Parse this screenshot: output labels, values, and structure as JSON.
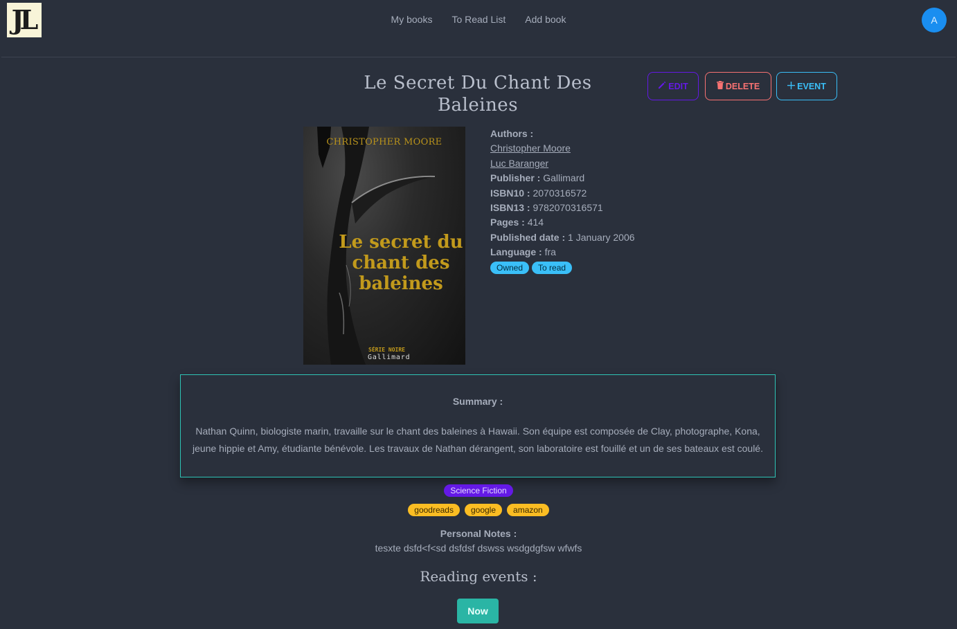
{
  "nav": {
    "logo_text": "JL",
    "links": [
      "My books",
      "To Read List",
      "Add book"
    ],
    "avatar_initial": "A"
  },
  "book": {
    "title": "Le Secret Du Chant Des Baleines",
    "cover": {
      "author": "CHRISTOPHER MOORE",
      "title": "Le secret du chant des baleines",
      "series": "SÉRIE NOIRE",
      "publisher": "Gallimard"
    },
    "authors_label": "Authors :",
    "authors": [
      "Christopher Moore",
      "Luc Baranger"
    ],
    "publisher_label": "Publisher :",
    "publisher": "Gallimard",
    "isbn10_label": "ISBN10 :",
    "isbn10": "2070316572",
    "isbn13_label": "ISBN13 :",
    "isbn13": "9782070316571",
    "pages_label": "Pages :",
    "pages": "414",
    "published_label": "Published date :",
    "published": "1 January 2006",
    "language_label": "Language :",
    "language": "fra",
    "status_badges": [
      "Owned",
      "To read"
    ]
  },
  "actions": {
    "edit": "EDIT",
    "delete": "DELETE",
    "event": "EVENT"
  },
  "summary": {
    "label": "Summary :",
    "text": "Nathan Quinn, biologiste marin, travaille sur le chant des baleines à Hawaii. Son équipe est composée de Clay, photographe, Kona, jeune hippie et Amy, étudiante bénévole. Les travaux de Nathan dérangent, son laboratoire est fouillé et un de ses bateaux est coulé."
  },
  "genre": "Science Fiction",
  "external_links": [
    "goodreads",
    "google",
    "amazon"
  ],
  "notes": {
    "label": "Personal Notes :",
    "text": "tesxte dsfd<f<sd dsfdsf dswss wsdgdgfsw wfwfs"
  },
  "events": {
    "title": "Reading events :",
    "now_button": "Now"
  },
  "colors": {
    "background": "#2a303c",
    "primary": "#6419e6",
    "error": "#f87272",
    "info": "#3abff8",
    "warning": "#fbbd23",
    "accent": "#2ab5a5"
  }
}
